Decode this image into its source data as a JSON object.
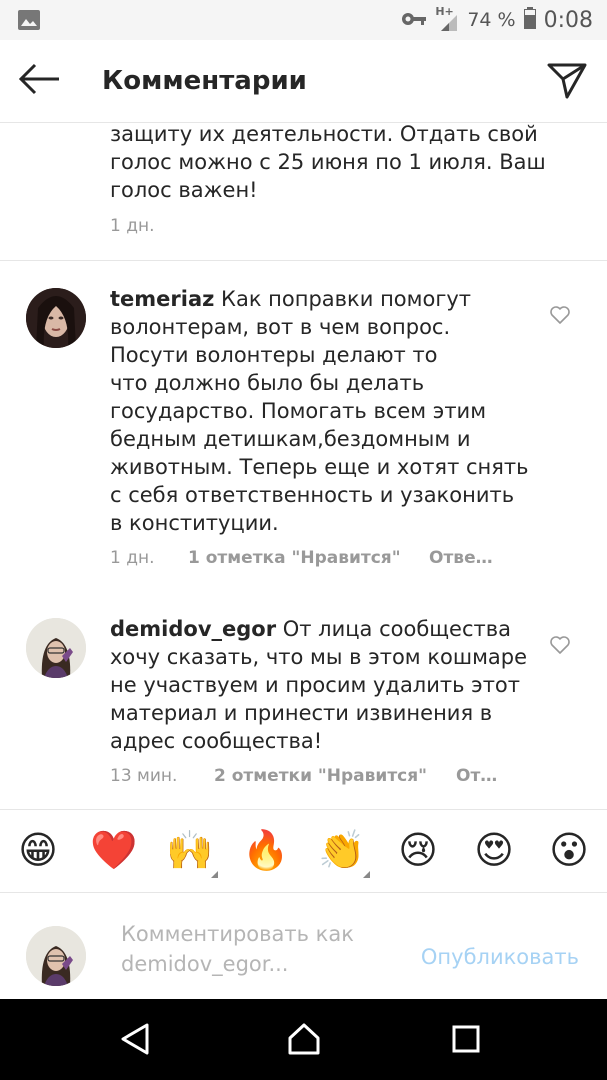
{
  "status_bar": {
    "network": "H+",
    "battery": "74 %",
    "time": "0:08"
  },
  "header": {
    "title": "Комментарии",
    "back_icon": "arrow-left-icon",
    "send_icon": "paper-plane-icon"
  },
  "comments": [
    {
      "text_lines": [
        "защиту их деятельности. Отдать свой",
        "голос можно с 25 июня по 1 июля. Ваш",
        "голос важен!"
      ],
      "time": "1 дн."
    },
    {
      "username": "temeriaz",
      "text_lines": [
        " Как поправки помогут",
        "волонтерам, вот в чем вопрос.",
        "Посути волонтеры делают то",
        "что должно было бы делать",
        "государство. Помогать всем этим",
        "бедным детишкам,бездомным и",
        "животным. Теперь еще и хотят снять",
        "с себя ответственность и узаконить",
        "в конституции."
      ],
      "time": "1 дн.",
      "likes": "1 отметка \"Нравится\"",
      "reply": "Отве…"
    },
    {
      "username": "demidov_egor",
      "text_lines": [
        " От лица сообщества",
        "хочу сказать, что мы в этом кошмаре",
        "не участвуем и просим удалить этот",
        "материал и принести извинения в",
        "адрес сообщества!"
      ],
      "time": "13 мин.",
      "likes": "2 отметки \"Нравится\"",
      "reply": "От…"
    }
  ],
  "emoji_bar": [
    "😁",
    "❤️",
    "🙌",
    "🔥",
    "👏",
    "😢",
    "😍",
    "😮"
  ],
  "composer": {
    "placeholder_line1": "Комментировать как",
    "placeholder_line2": "demidov_egor...",
    "post_label": "Опубликовать"
  },
  "colors": {
    "text": "#262626",
    "meta": "#999999",
    "post_disabled": "#a6d2f4",
    "divider": "#e6e6e6"
  }
}
